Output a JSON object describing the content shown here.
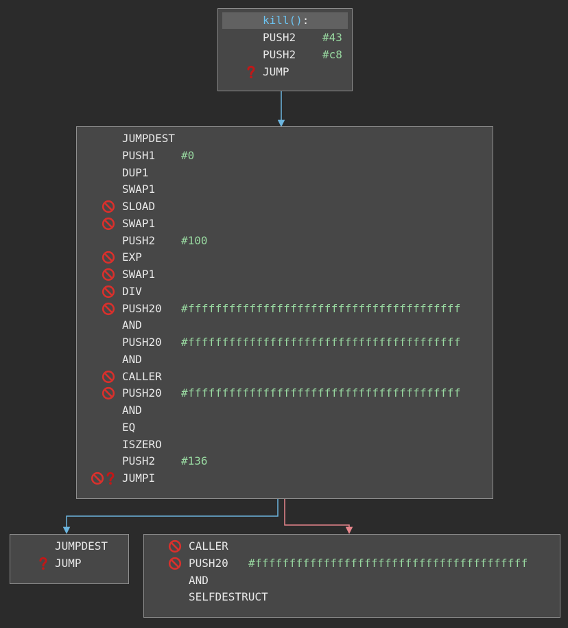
{
  "blocks": [
    {
      "id": "entry",
      "rows": [
        {
          "fn": "kill()",
          "colon": ":",
          "highlight": true
        },
        {
          "op": "PUSH2",
          "arg": "#43"
        },
        {
          "op": "PUSH2",
          "arg": "#c8"
        },
        {
          "op": "JUMP",
          "icons": [
            "question-icon"
          ]
        }
      ]
    },
    {
      "id": "check",
      "rows": [
        {
          "op": "JUMPDEST"
        },
        {
          "op": "PUSH1",
          "arg": "#0"
        },
        {
          "op": "DUP1"
        },
        {
          "op": "SWAP1"
        },
        {
          "op": "SLOAD",
          "icons": [
            "prohibited-icon"
          ]
        },
        {
          "op": "SWAP1",
          "icons": [
            "prohibited-icon"
          ]
        },
        {
          "op": "PUSH2",
          "arg": "#100"
        },
        {
          "op": "EXP",
          "icons": [
            "prohibited-icon"
          ]
        },
        {
          "op": "SWAP1",
          "icons": [
            "prohibited-icon"
          ]
        },
        {
          "op": "DIV",
          "icons": [
            "prohibited-icon"
          ]
        },
        {
          "op": "PUSH20",
          "arg": "#ffffffffffffffffffffffffffffffffffffffff",
          "icons": [
            "prohibited-icon"
          ]
        },
        {
          "op": "AND"
        },
        {
          "op": "PUSH20",
          "arg": "#ffffffffffffffffffffffffffffffffffffffff"
        },
        {
          "op": "AND"
        },
        {
          "op": "CALLER",
          "icons": [
            "prohibited-icon"
          ]
        },
        {
          "op": "PUSH20",
          "arg": "#ffffffffffffffffffffffffffffffffffffffff",
          "icons": [
            "prohibited-icon"
          ]
        },
        {
          "op": "AND"
        },
        {
          "op": "EQ"
        },
        {
          "op": "ISZERO"
        },
        {
          "op": "PUSH2",
          "arg": "#136"
        },
        {
          "op": "JUMPI",
          "icons": [
            "prohibited-icon",
            "question-icon"
          ]
        }
      ]
    },
    {
      "id": "revert",
      "rows": [
        {
          "op": "JUMPDEST"
        },
        {
          "op": "JUMP",
          "icons": [
            "question-icon"
          ]
        }
      ]
    },
    {
      "id": "destruct",
      "rows": [
        {
          "op": "CALLER",
          "icons": [
            "prohibited-icon"
          ]
        },
        {
          "op": "PUSH20",
          "arg": "#ffffffffffffffffffffffffffffffffffffffff",
          "icons": [
            "prohibited-icon"
          ]
        },
        {
          "op": "AND"
        },
        {
          "op": "SELFDESTRUCT"
        }
      ]
    }
  ],
  "edges": [
    {
      "from": "entry",
      "to": "check",
      "kind": "unconditional",
      "color": "#6cb6e0"
    },
    {
      "from": "check",
      "to": "revert",
      "kind": "true-branch",
      "color": "#6cb6e0"
    },
    {
      "from": "check",
      "to": "destruct",
      "kind": "false-branch",
      "color": "#e8868c"
    }
  ],
  "colors": {
    "background": "#2b2b2b",
    "block": "#474747",
    "opcode": "#e8e8e8",
    "argument": "#98d8a0",
    "function": "#6cc3f0",
    "prohibited": "#d9302c",
    "question": "#c01818"
  }
}
